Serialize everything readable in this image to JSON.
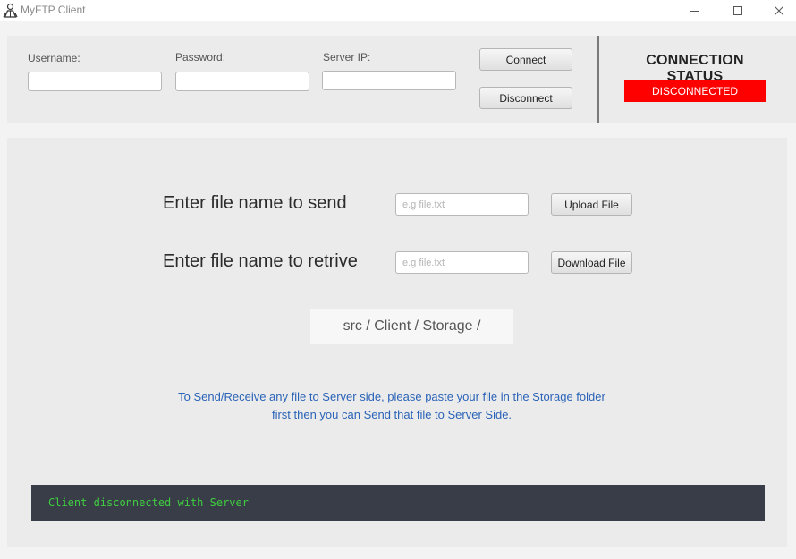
{
  "window": {
    "title": "MyFTP Client",
    "icon": "user-group-icon",
    "controls": {
      "minimize": "─",
      "maximize": "☐",
      "close": "✕"
    }
  },
  "connection": {
    "username_label": "Username:",
    "password_label": "Password:",
    "server_ip_label": "Server IP:",
    "username_value": "",
    "password_value": "",
    "server_ip_value": "",
    "connect_label": "Connect",
    "disconnect_label": "Disconnect"
  },
  "status": {
    "title": "CONNECTION STATUS",
    "value": "DISCONNECTED",
    "color": "#ff0000"
  },
  "transfer": {
    "send_label": "Enter file name to send",
    "send_placeholder": "e.g file.txt",
    "send_value": "",
    "upload_label": "Upload File",
    "retrieve_label": "Enter file name to retrive",
    "retrieve_placeholder": "e.g file.txt",
    "retrieve_value": "",
    "download_label": "Download File",
    "storage_path": "src / Client / Storage /",
    "info_line1": "To Send/Receive any file to Server side, please paste your file in the Storage folder",
    "info_line2": "first then you can Send that file to Server Side.",
    "info_color": "#2a63b8"
  },
  "console": {
    "message": "Client disconnected with Server",
    "text_color": "#3fce3f",
    "background": "#383d48"
  }
}
